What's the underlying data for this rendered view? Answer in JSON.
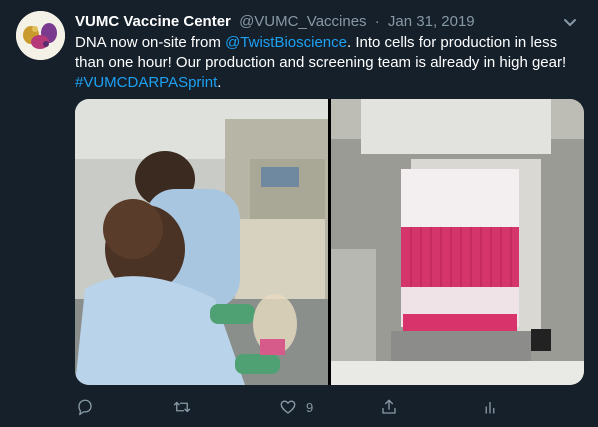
{
  "tweet": {
    "display_name": "VUMC Vaccine Center",
    "handle": "@VUMC_Vaccines",
    "separator": "·",
    "date": "Jan 31, 2019",
    "text_part1": "DNA now on-site from ",
    "mention": "@TwistBioscience",
    "text_part2": ". Into cells for production in less than one hour!  Our production and screening team is already in high gear! ",
    "hashtag": "#VUMCDARPASprint",
    "text_end": "."
  },
  "actions": {
    "reply_icon": "reply-icon",
    "retweet_icon": "retweet-icon",
    "like_icon": "heart-icon",
    "like_count": "9",
    "share_icon": "share-icon",
    "analytics_icon": "analytics-icon"
  },
  "colors": {
    "background": "#15202b",
    "link": "#1da1f2",
    "muted": "#8899a6",
    "text": "#ffffff"
  }
}
